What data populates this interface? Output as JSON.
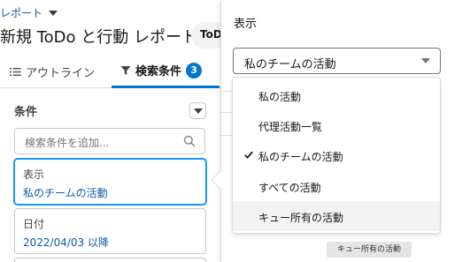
{
  "breadcrumb": {
    "label": "レポート"
  },
  "report": {
    "title": "新規 ToDo と行動 レポート",
    "todo_chip": "ToD"
  },
  "tabs": [
    {
      "label": "アウトライン",
      "icon": "list-icon"
    },
    {
      "label": "検索条件",
      "icon": "filter-icon",
      "count": "3"
    }
  ],
  "filters": {
    "section_label": "条件",
    "search_placeholder": "検索条件を追加...",
    "cards": [
      {
        "label": "表示",
        "value": "私のチームの活動"
      },
      {
        "label": "日付",
        "value": "2022/04/03 以降"
      }
    ]
  },
  "panel": {
    "title": "表示",
    "selected": "私のチームの活動",
    "options": [
      {
        "label": "私の活動",
        "checked": false,
        "hover": false
      },
      {
        "label": "代理活動一覧",
        "checked": false,
        "hover": false
      },
      {
        "label": "私のチームの活動",
        "checked": true,
        "hover": false
      },
      {
        "label": "すべての活動",
        "checked": false,
        "hover": false
      },
      {
        "label": "キュー所有の活動",
        "checked": false,
        "hover": true
      }
    ],
    "tooltip": "キュー所有の活動",
    "faint_text": "... ..... ... .. .. ..."
  },
  "colors": {
    "accent": "#0176d3",
    "link": "#0b5cab",
    "focus": "#1b96ff"
  }
}
